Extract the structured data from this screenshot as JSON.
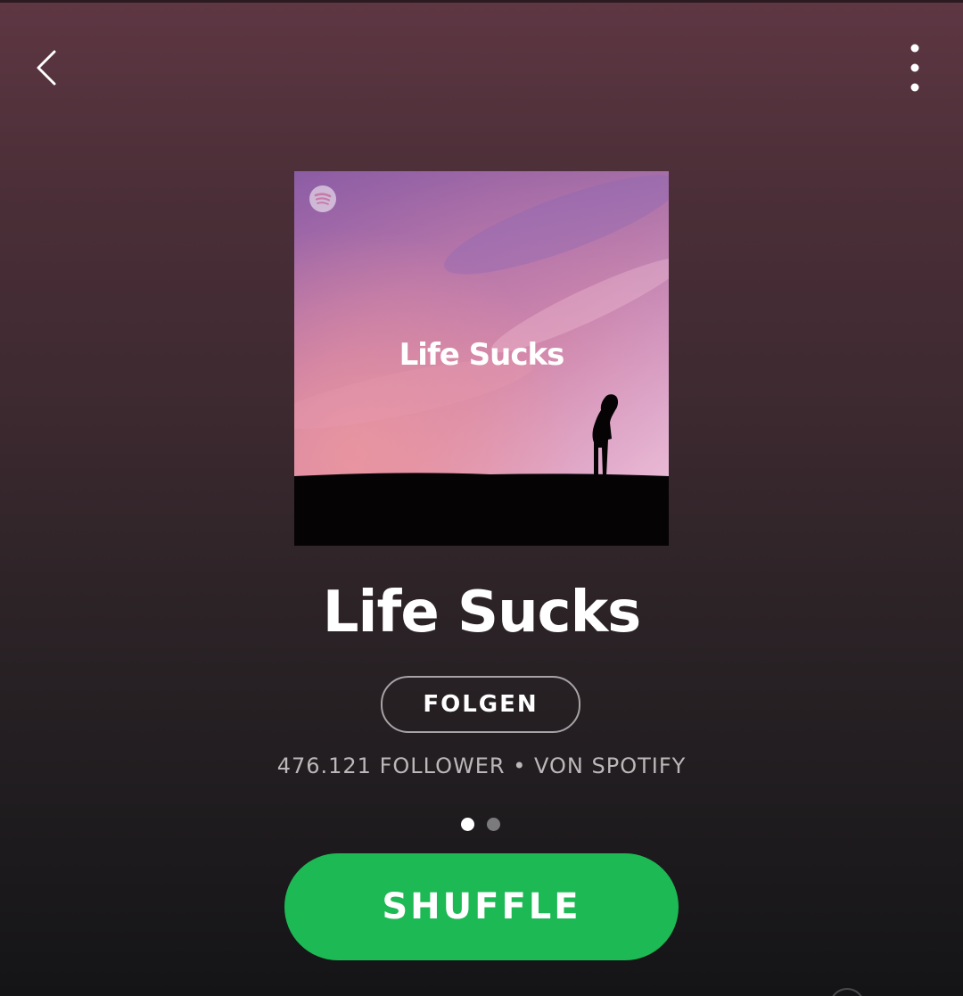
{
  "header": {
    "back_icon": "chevron-left-icon",
    "more_icon": "vertical-dots-icon"
  },
  "cover": {
    "title": "Life Sucks",
    "logo_icon": "spotify-logo-icon"
  },
  "playlist": {
    "title": "Life Sucks",
    "follow_label": "FOLGEN",
    "meta": "476.121 FOLLOWER • VON SPOTIFY"
  },
  "pager": {
    "count": 2,
    "active_index": 0
  },
  "actions": {
    "shuffle_label": "SHUFFLE"
  },
  "colors": {
    "accent_green": "#1db954",
    "text_primary": "#ffffff",
    "text_secondary": "#bcb8ba",
    "background_top": "#5e3743",
    "background_bottom": "#141416"
  }
}
